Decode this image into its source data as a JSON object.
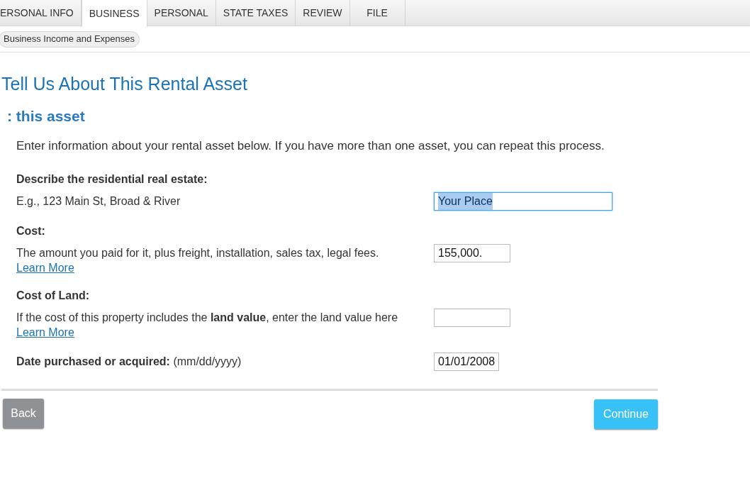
{
  "tabs": [
    {
      "label": "ERSONAL INFO",
      "selected": false
    },
    {
      "label": "BUSINESS",
      "selected": true
    },
    {
      "label": "PERSONAL",
      "selected": false
    },
    {
      "label": "STATE TAXES",
      "selected": false
    },
    {
      "label": "REVIEW",
      "selected": false
    },
    {
      "label": "FILE",
      "selected": false
    }
  ],
  "breadcrumb": "Business Income and Expenses",
  "title": "Tell Us About This Rental Asset",
  "subtitle": ": this asset",
  "intro": "Enter information about your rental asset below. If you have more than one asset, you can repeat this process.",
  "fields": [
    {
      "kind": "wide",
      "label": "Describe the residential real estate:",
      "help": "E.g., 123 Main St, Broad & River",
      "value": "Your Place",
      "focused": true,
      "text_selected": true
    },
    {
      "kind": "short",
      "label": "Cost:",
      "help": "The amount you paid for it, plus freight, installation, sales tax, legal fees.",
      "link": "Learn More",
      "value": "155,000.",
      "focused": false
    },
    {
      "kind": "short",
      "label": "Cost of Land:",
      "help": "If the cost of this property includes the **land value**, enter the land value here",
      "link": "Learn More",
      "focused": false
    },
    {
      "kind": "inline",
      "label": "Date purchased or acquired:",
      "help": "(mm/dd/yyyy)",
      "value": "01/01/2008",
      "focused": false
    }
  ],
  "buttons": {
    "back": "Back",
    "continue": "Continue"
  }
}
